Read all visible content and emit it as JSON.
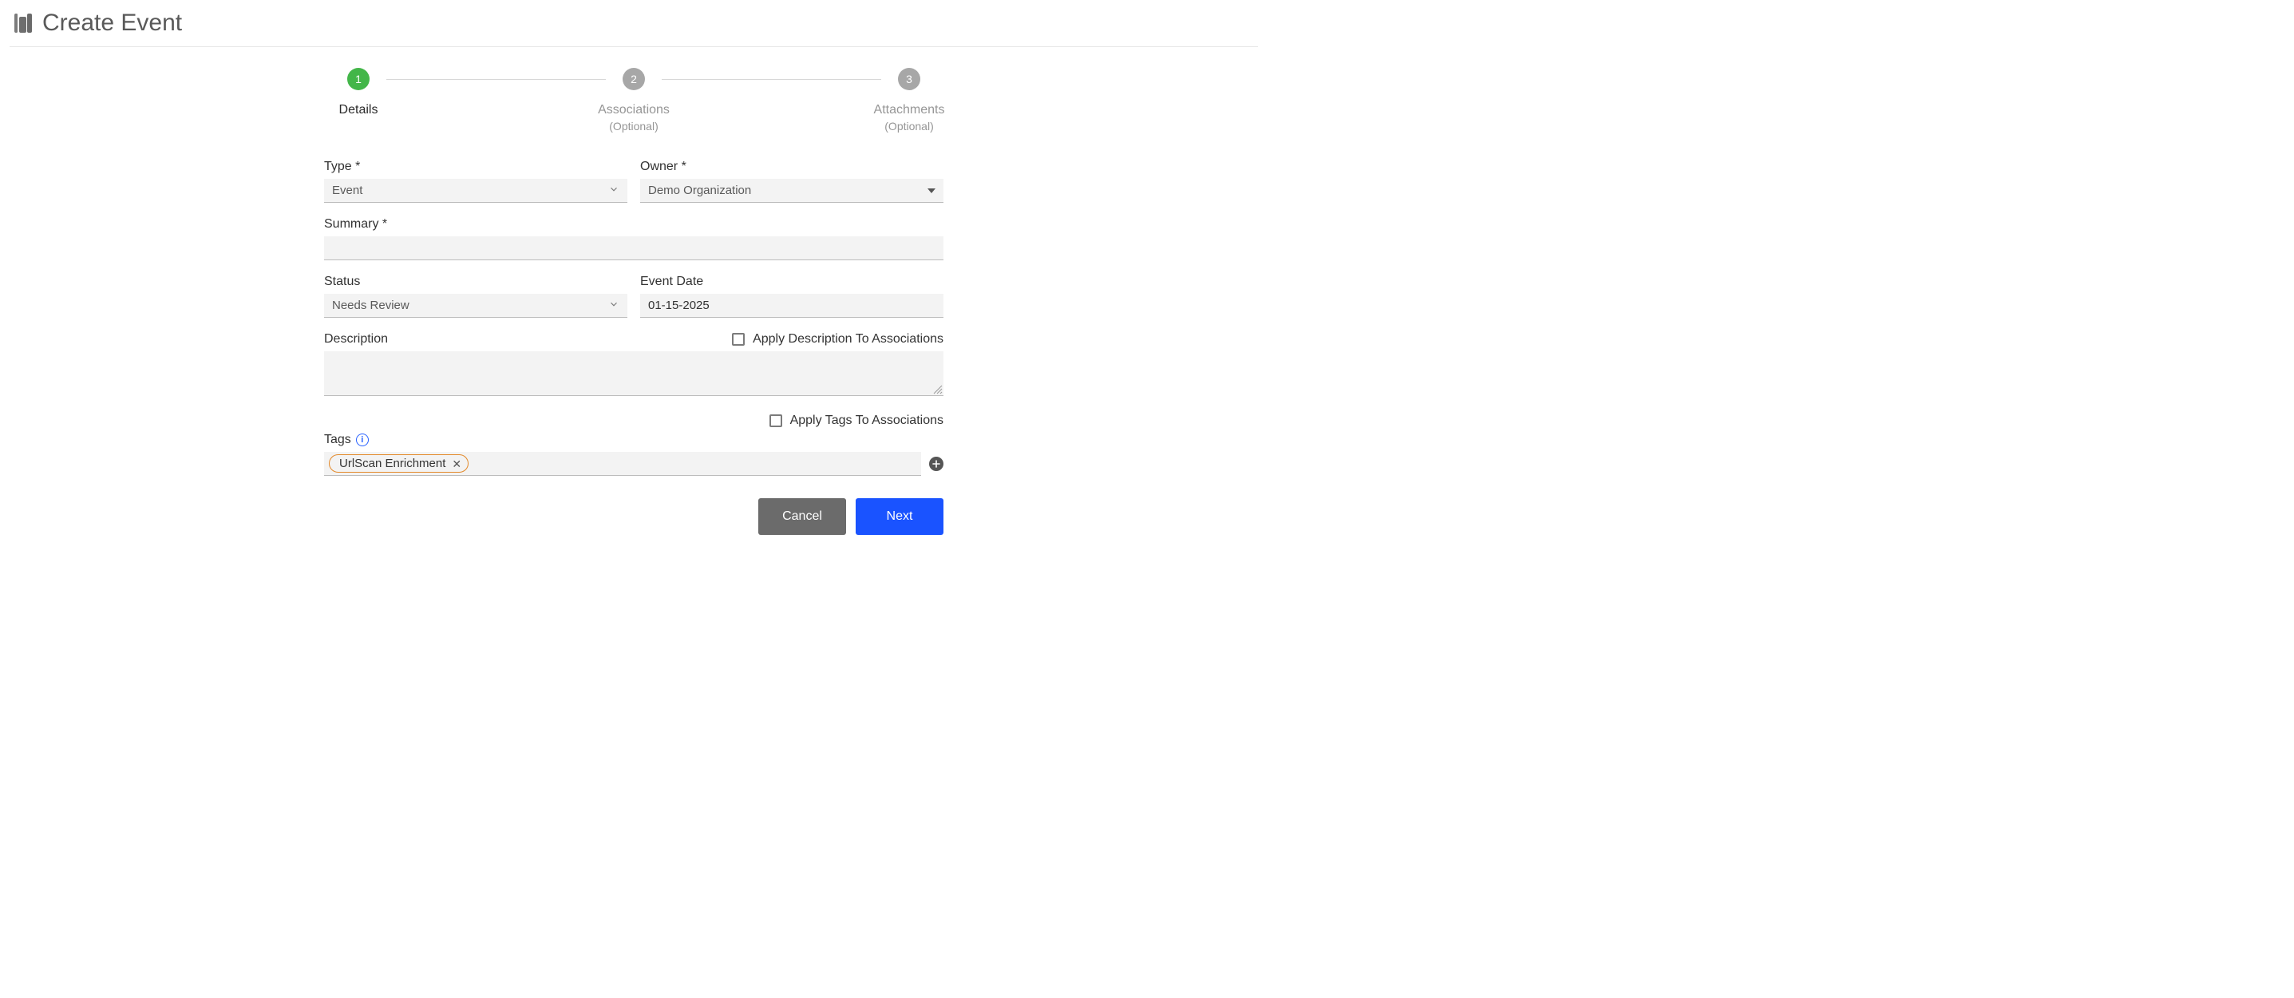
{
  "header": {
    "title": "Create Event"
  },
  "stepper": {
    "steps": [
      {
        "num": "1",
        "label": "Details",
        "sublabel": "",
        "active": true
      },
      {
        "num": "2",
        "label": "Associations",
        "sublabel": "(Optional)",
        "active": false
      },
      {
        "num": "3",
        "label": "Attachments",
        "sublabel": "(Optional)",
        "active": false
      }
    ]
  },
  "form": {
    "type_label": "Type *",
    "type_value": "Event",
    "owner_label": "Owner *",
    "owner_value": "Demo Organization",
    "summary_label": "Summary *",
    "summary_value": "",
    "status_label": "Status",
    "status_value": "Needs Review",
    "eventdate_label": "Event Date",
    "eventdate_value": "01-15-2025",
    "description_label": "Description",
    "description_value": "",
    "apply_desc_label": "Apply Description To Associations",
    "apply_tags_label": "Apply Tags To Associations",
    "tags_label": "Tags",
    "tags": [
      {
        "name": "UrlScan Enrichment"
      }
    ]
  },
  "buttons": {
    "cancel": "Cancel",
    "next": "Next"
  }
}
